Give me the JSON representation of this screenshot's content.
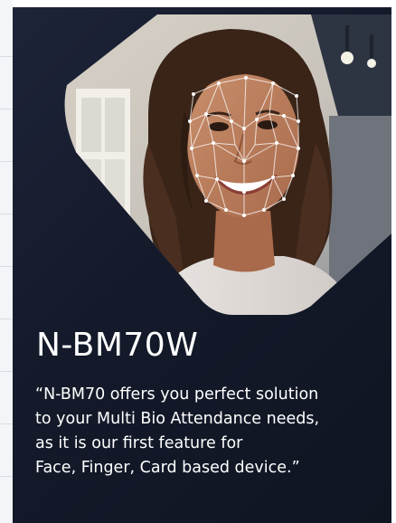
{
  "product": {
    "title": "N-BM70W",
    "quote_lines": [
      "“N-BM70 offers you perfect solution",
      "to your Multi Bio Attendance needs,",
      "as it is our first feature for",
      "Face, Finger, Card based device.”"
    ]
  },
  "hero": {
    "image_icon": "face-recognition-portrait-icon",
    "overlay_icon": "face-mesh-icon"
  },
  "colors": {
    "card_background": "#151a2b",
    "text": "#ffffff",
    "mesh": "#ffffff"
  }
}
